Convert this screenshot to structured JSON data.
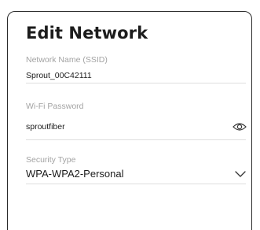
{
  "header": {
    "title": "Edit Network"
  },
  "form": {
    "ssid": {
      "label": "Network Name (SSID)",
      "value": "Sprout_00C42111"
    },
    "password": {
      "label": "Wi-Fi Password",
      "value": "sproutfiber",
      "toggle_icon": "eye-icon"
    },
    "security": {
      "label": "Security Type",
      "value": "WPA-WPA2-Personal",
      "dropdown_icon": "chevron-down-icon"
    }
  },
  "colors": {
    "text": "#1c1c1c",
    "label": "#a3a3a3",
    "border": "#2b2b2b",
    "divider": "#dedede"
  }
}
